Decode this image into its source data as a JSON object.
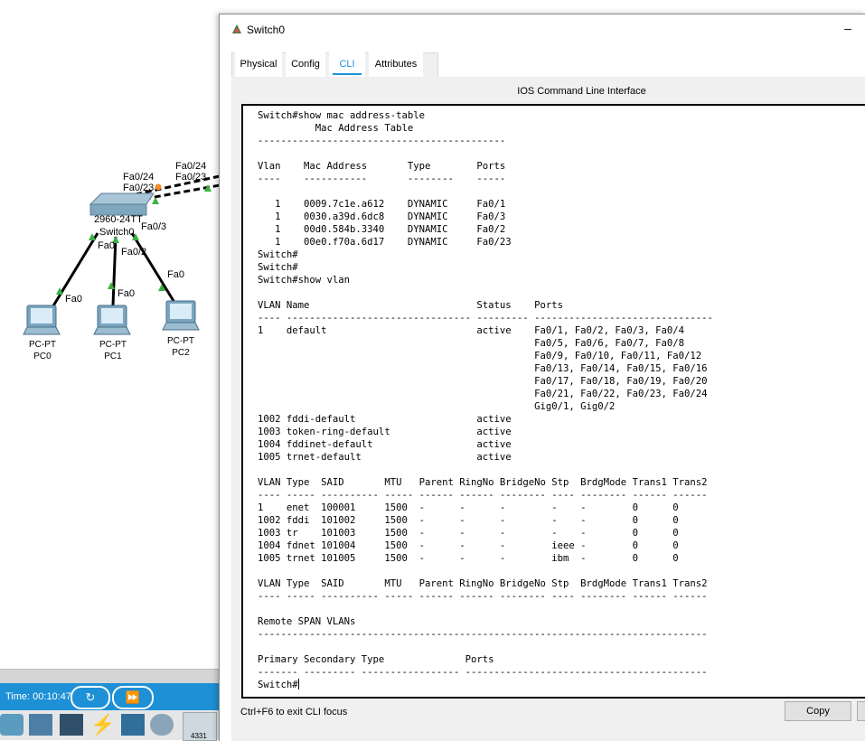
{
  "topology": {
    "switch": {
      "model": "2960-24TT",
      "name": "Switch0"
    },
    "ports": {
      "uplink_a": "Fa0/24",
      "uplink_b": "Fa0/23",
      "uplink_a_right": "Fa0/24",
      "uplink_b_right": "Fa0/23",
      "sw_fa01": "Fa0",
      "sw_fa02": "Fa0/2",
      "sw_fa03": "Fa0/3",
      "pc0_port": "Fa0",
      "pc1_port": "Fa0",
      "pc2_port": "Fa0"
    },
    "pcs": [
      {
        "type": "PC-PT",
        "name": "PC0"
      },
      {
        "type": "PC-PT",
        "name": "PC1"
      },
      {
        "type": "PC-PT",
        "name": "PC2"
      }
    ]
  },
  "timebar": {
    "time": "Time: 00:10:47"
  },
  "devices": {
    "router_label": "4331"
  },
  "window": {
    "title": "Switch0",
    "minimize": "–",
    "tabs": [
      "Physical",
      "Config",
      "CLI",
      "Attributes"
    ],
    "active_tab": "CLI",
    "panel_title": "IOS Command Line Interface",
    "terminal_lines": [
      "Switch#show mac address-table",
      "          Mac Address Table",
      "-------------------------------------------",
      "",
      "Vlan    Mac Address       Type        Ports",
      "----    -----------       --------    -----",
      "",
      "   1    0009.7c1e.a612    DYNAMIC     Fa0/1",
      "   1    0030.a39d.6dc8    DYNAMIC     Fa0/3",
      "   1    00d0.584b.3340    DYNAMIC     Fa0/2",
      "   1    00e0.f70a.6d17    DYNAMIC     Fa0/23",
      "Switch#",
      "Switch#",
      "Switch#show vlan",
      "",
      "VLAN Name                             Status    Ports",
      "---- -------------------------------- --------- -------------------------------",
      "1    default                          active    Fa0/1, Fa0/2, Fa0/3, Fa0/4",
      "                                                Fa0/5, Fa0/6, Fa0/7, Fa0/8",
      "                                                Fa0/9, Fa0/10, Fa0/11, Fa0/12",
      "                                                Fa0/13, Fa0/14, Fa0/15, Fa0/16",
      "                                                Fa0/17, Fa0/18, Fa0/19, Fa0/20",
      "                                                Fa0/21, Fa0/22, Fa0/23, Fa0/24",
      "                                                Gig0/1, Gig0/2",
      "1002 fddi-default                     active",
      "1003 token-ring-default               active",
      "1004 fddinet-default                  active",
      "1005 trnet-default                    active",
      "",
      "VLAN Type  SAID       MTU   Parent RingNo BridgeNo Stp  BrdgMode Trans1 Trans2",
      "---- ----- ---------- ----- ------ ------ -------- ---- -------- ------ ------",
      "1    enet  100001     1500  -      -      -        -    -        0      0",
      "1002 fddi  101002     1500  -      -      -        -    -        0      0",
      "1003 tr    101003     1500  -      -      -        -    -        0      0",
      "1004 fdnet 101004     1500  -      -      -        ieee -        0      0",
      "1005 trnet 101005     1500  -      -      -        ibm  -        0      0",
      "",
      "VLAN Type  SAID       MTU   Parent RingNo BridgeNo Stp  BrdgMode Trans1 Trans2",
      "---- ----- ---------- ----- ------ ------ -------- ---- -------- ------ ------",
      "",
      "Remote SPAN VLANs",
      "------------------------------------------------------------------------------",
      "",
      "Primary Secondary Type              Ports",
      "------- --------- ----------------- ------------------------------------------",
      "Switch#"
    ],
    "hint": "Ctrl+F6 to exit CLI focus",
    "copy_label": "Copy"
  }
}
